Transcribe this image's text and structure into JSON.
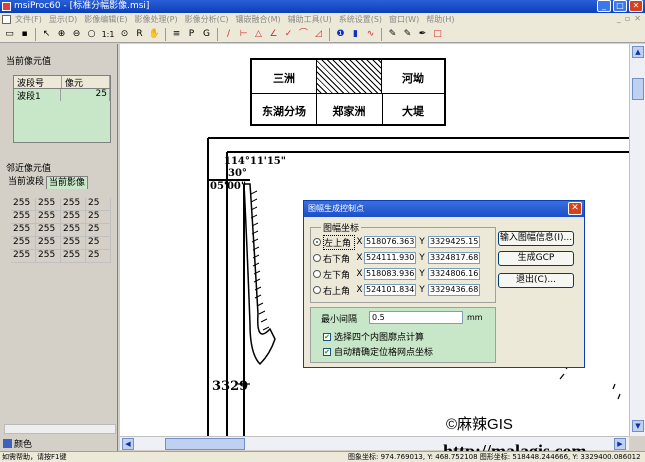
{
  "window": {
    "title": "msiProc60 - [标准分幅影像.msi]"
  },
  "menu": {
    "items": [
      "文件(F)",
      "显示(D)",
      "影像编辑(E)",
      "影像处理(P)",
      "影像分析(C)",
      "镶嵌融合(M)",
      "辅助工具(U)",
      "系统设置(S)",
      "窗口(W)",
      "帮助(H)"
    ]
  },
  "toolbar": {
    "zoom_label": "1:1"
  },
  "left_panel": {
    "current_pixel_label": "当前像元值",
    "cur_table": {
      "headers": [
        "波段号",
        "像元"
      ],
      "rows": [
        [
          "波段1",
          "25"
        ]
      ]
    },
    "neighbor_label": "邻近像元值",
    "tabs": [
      "当前波段",
      "当前影像"
    ],
    "neighbor_grid": [
      [
        "255",
        "255",
        "255",
        "25"
      ],
      [
        "255",
        "255",
        "255",
        "25"
      ],
      [
        "255",
        "255",
        "255",
        "25"
      ],
      [
        "255",
        "255",
        "255",
        "25"
      ],
      [
        "255",
        "255",
        "255",
        "25"
      ]
    ],
    "bottom_tab": "颜色"
  },
  "map": {
    "cells": [
      "三洲",
      "河坳",
      "东湖分场",
      "郑家洲",
      "大堤"
    ],
    "coord_top": "114°11'15\"",
    "coord_lat1": "30°",
    "coord_lat2": "05'00\"",
    "coord_bottom": "3329"
  },
  "dialog": {
    "title": "图幅生成控制点",
    "group_title": "图幅坐标",
    "corners": [
      {
        "label": "左上角",
        "x": "518076.363",
        "y": "3329425.15",
        "selected": true
      },
      {
        "label": "右下角",
        "x": "524111.930",
        "y": "3324817.68",
        "selected": false
      },
      {
        "label": "左下角",
        "x": "518083.936",
        "y": "3324806.16",
        "selected": false
      },
      {
        "label": "右上角",
        "x": "524101.834",
        "y": "3329436.68",
        "selected": false
      }
    ],
    "axis_x": "X",
    "axis_y": "Y",
    "btn_input": "输入图幅信息(I)...",
    "btn_generate": "生成GCP",
    "btn_exit": "退出(C)...",
    "interval_label": "最小间隔",
    "interval_value": "0.5",
    "interval_unit": "mm",
    "check1": "选择四个内图廓点计算",
    "check2": "自动精确定位格网点坐标"
  },
  "watermark": {
    "line1": "©麻辣GIS",
    "line2": "http://malagis.com"
  },
  "status": {
    "left": "如需帮助，请按F1键",
    "right": "图象坐标: 974.769013, Y: 468.752108   图形坐标: 518448.244666, Y: 3329400.086012"
  }
}
